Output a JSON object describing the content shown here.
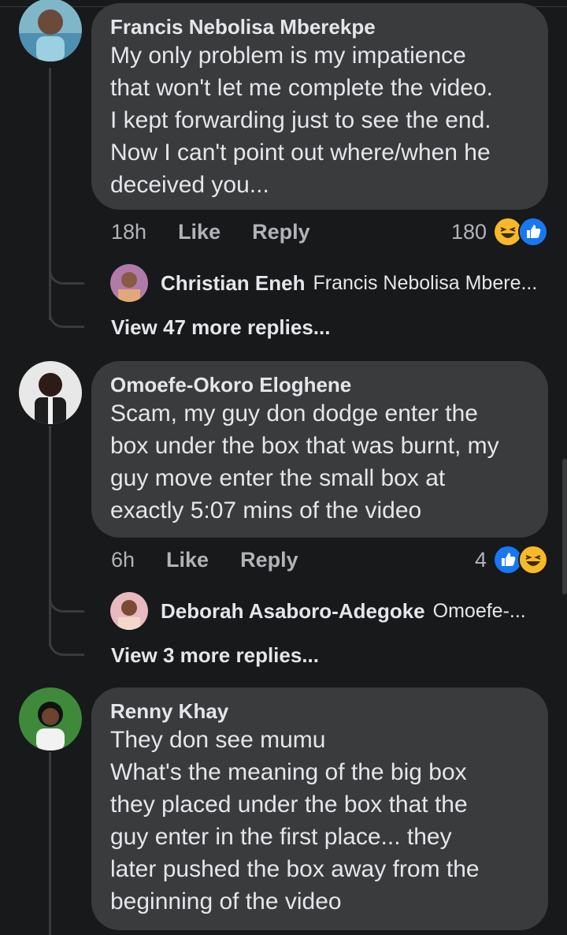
{
  "comments": [
    {
      "author": "Francis Nebolisa Mberekpe",
      "text": "My only problem is my impatience\nthat won't let me complete the video.\nI kept forwarding just to see the end.\nNow I can't point out where/when he\ndeceived you...",
      "time": "18h",
      "like": "Like",
      "reply": "Reply",
      "reaction_count": "180",
      "reactions": [
        "haha-icon",
        "like-icon"
      ],
      "reply_preview": {
        "author": "Christian Eneh",
        "snippet": "Francis Nebolisa Mbere..."
      },
      "more_replies": "View 47 more replies..."
    },
    {
      "author": "Omoefe-Okoro Eloghene",
      "text": "Scam, my guy don dodge enter the\nbox under the box that was burnt, my\nguy move enter the small box at\nexactly 5:07 mins of the video",
      "time": "6h",
      "like": "Like",
      "reply": "Reply",
      "reaction_count": "4",
      "reactions": [
        "like-icon",
        "haha-icon"
      ],
      "reply_preview": {
        "author": "Deborah Asaboro-Adegoke",
        "snippet": "Omoefe-..."
      },
      "more_replies": "View 3 more replies..."
    },
    {
      "author": "Renny Khay",
      "text": "They don see mumu\nWhat's the meaning of the big box\nthey placed under the box that the\nguy enter in the first place...  they\nlater pushed the box away from the\nbeginning of the video"
    }
  ],
  "colors": {
    "background": "#18191a",
    "bubble": "#3a3b3c",
    "like_blue": "#1877f2",
    "haha_yellow": "#f7b928"
  }
}
